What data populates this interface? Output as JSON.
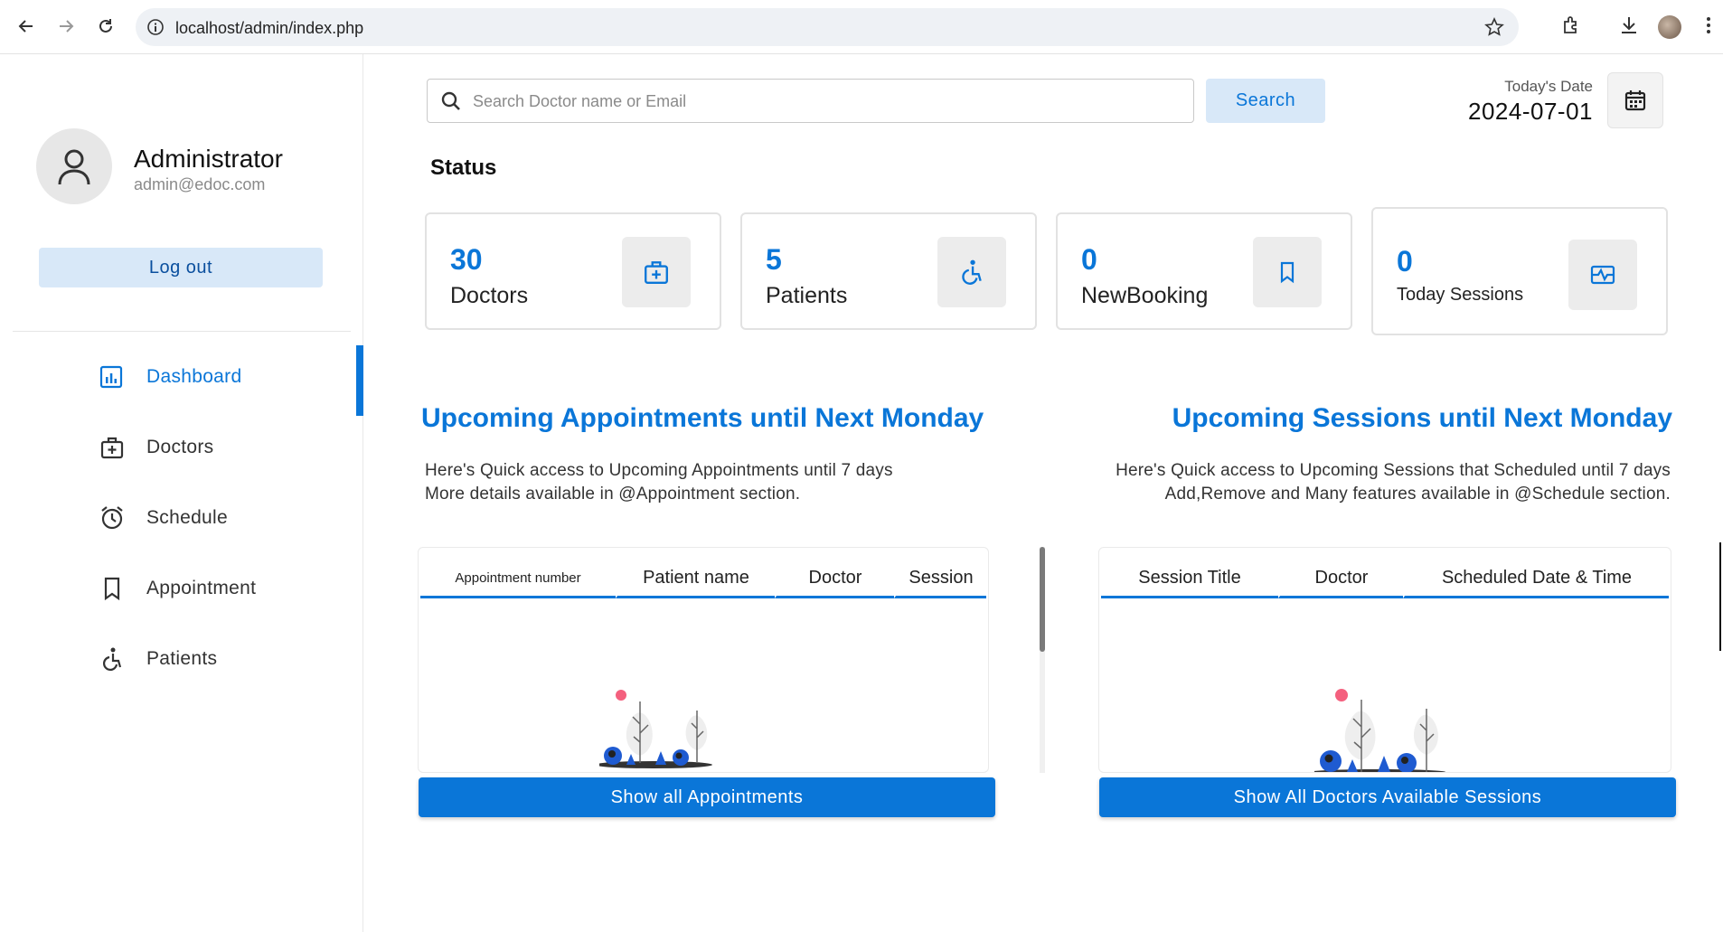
{
  "browser": {
    "url": "localhost/admin/index.php"
  },
  "sidebar": {
    "profile": {
      "name": "Administrator",
      "email": "admin@edoc.com"
    },
    "logout_label": "Log out",
    "items": [
      {
        "label": "Dashboard",
        "icon": "dashboard-icon",
        "active": true
      },
      {
        "label": "Doctors",
        "icon": "doctors-icon",
        "active": false
      },
      {
        "label": "Schedule",
        "icon": "schedule-icon",
        "active": false
      },
      {
        "label": "Appointment",
        "icon": "appointment-icon",
        "active": false
      },
      {
        "label": "Patients",
        "icon": "patients-icon",
        "active": false
      }
    ]
  },
  "search": {
    "placeholder": "Search Doctor name or Email",
    "button_label": "Search"
  },
  "date": {
    "label": "Today's Date",
    "value": "2024-07-01"
  },
  "status": {
    "title": "Status",
    "cards": [
      {
        "value": "30",
        "label": "Doctors",
        "icon": "doctors-icon"
      },
      {
        "value": "5",
        "label": "Patients",
        "icon": "patients-icon"
      },
      {
        "value": "0",
        "label": "NewBooking",
        "icon": "bookmark-icon"
      },
      {
        "value": "0",
        "label": "Today Sessions",
        "icon": "sessions-icon"
      }
    ]
  },
  "appointments": {
    "heading": "Upcoming Appointments until Next Monday",
    "desc_line1": "Here's Quick access to Upcoming Appointments until 7 days",
    "desc_line2": "More details available in @Appointment section.",
    "columns": [
      "Appointment number",
      "Patient name",
      "Doctor",
      "Session"
    ],
    "button_label": "Show all Appointments"
  },
  "sessions": {
    "heading": "Upcoming Sessions until Next Monday",
    "desc_line1": "Here's Quick access to Upcoming Sessions that Scheduled until 7 days",
    "desc_line2": "Add,Remove and Many features available in @Schedule section.",
    "columns": [
      "Session Title",
      "Doctor",
      "Scheduled Date & Time"
    ],
    "button_label": "Show All Doctors Available Sessions"
  },
  "colors": {
    "accent": "#0a76d8",
    "accent_light": "#d8e8f8"
  }
}
